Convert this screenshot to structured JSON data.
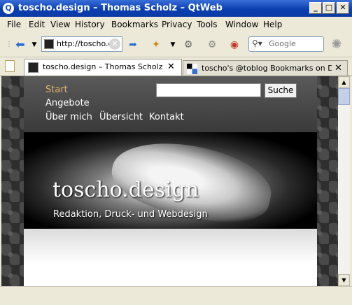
{
  "window": {
    "title": "toscho.design – Thomas Scholz – QtWeb",
    "app_icon": "Q",
    "controls": {
      "minimize": "_",
      "maximize": "□",
      "close": "✕"
    }
  },
  "menu": [
    "File",
    "Edit",
    "View",
    "History",
    "Bookmarks",
    "Privacy",
    "Tools",
    "Window",
    "Help"
  ],
  "toolbar": {
    "back_icon": "back-arrow-icon",
    "url": "http://toscho.de",
    "clear_icon": "clear-icon",
    "search_placeholder": "Google"
  },
  "tabs": [
    {
      "label": "toscho.design – Thomas Scholz",
      "active": true,
      "close": "✕"
    },
    {
      "label": "toscho's @toblog Bookmarks on Delic",
      "active": false,
      "close": "✕"
    }
  ],
  "site": {
    "nav": {
      "start": "Start",
      "angebote": "Angebote",
      "ueber_mich": "Über mich",
      "uebersicht": "Übersicht",
      "kontakt": "Kontakt"
    },
    "search_button": "Suche",
    "search_value": "",
    "title": "toscho.design",
    "subtitle": "Redaktion, Druck- und Webdesign"
  },
  "colors": {
    "titlebar": "#0a3fb0",
    "nav_current": "#e3b46e",
    "chrome": "#ece9d8"
  }
}
